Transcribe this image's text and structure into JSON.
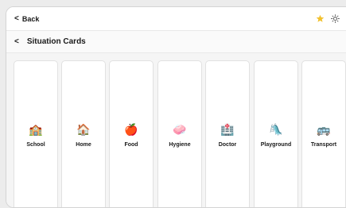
{
  "topbar": {
    "back_label": "Back",
    "back_chevron": "<",
    "icons": [
      "star-icon",
      "sun-icon"
    ]
  },
  "header": {
    "chevron": "<",
    "title": "Situation Cards"
  },
  "cards": [
    {
      "label": "School",
      "emoji": "🏫"
    },
    {
      "label": "Home",
      "emoji": "🏠"
    },
    {
      "label": "Food",
      "emoji": "🍎"
    },
    {
      "label": "Hygiene",
      "emoji": "🧼"
    },
    {
      "label": "Doctor",
      "emoji": "🏥"
    },
    {
      "label": "Playground",
      "emoji": "🛝"
    },
    {
      "label": "Transport",
      "emoji": "🚌"
    }
  ],
  "colors": {
    "star": "#f2c12e",
    "background": "#ececec",
    "card": "#ffffff",
    "border": "#e1e1e1"
  }
}
